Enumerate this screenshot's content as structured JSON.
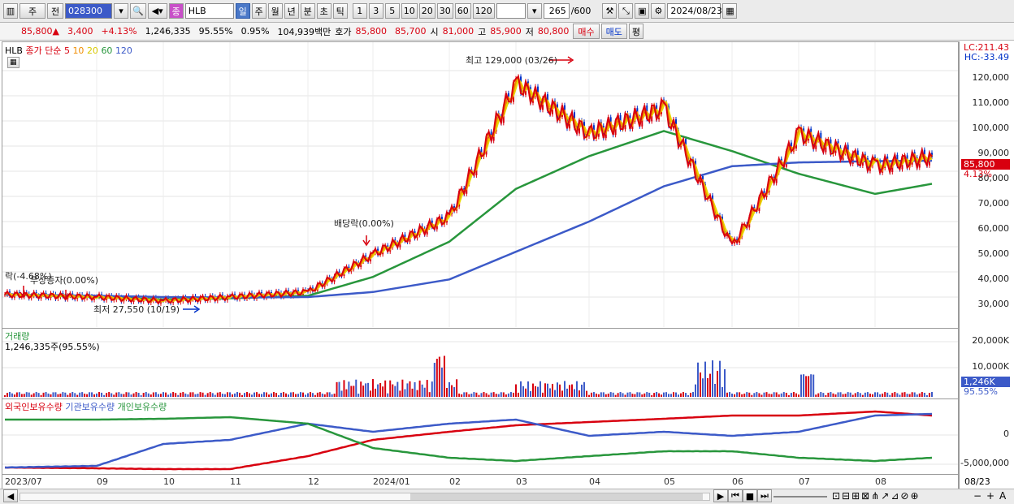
{
  "toolbar": {
    "type": "주",
    "prev": "전",
    "code": "028300",
    "product_icon": "종",
    "name": "HLB",
    "periods": [
      "일",
      "주",
      "월",
      "년",
      "분",
      "초",
      "틱"
    ],
    "active_period": "일",
    "nums": [
      "1",
      "3",
      "5",
      "10",
      "20",
      "30",
      "60",
      "120"
    ],
    "count": "265",
    "count_max": "/600",
    "date": "2024/08/23"
  },
  "quote": {
    "price": "85,800",
    "arrow": "▲",
    "change": "3,400",
    "pct": "+4.13%",
    "volume": "1,246,335",
    "vol_ratio": "95.55%",
    "turnover": "0.95%",
    "amount": "104,939백만",
    "hoga_label": "호가",
    "ask": "85,800",
    "bid": "85,700",
    "open_label": "시",
    "open": "81,000",
    "high_label": "고",
    "high": "85,900",
    "low_label": "저",
    "low": "80,800",
    "buy": "매수",
    "sell": "매도",
    "avg": "평"
  },
  "legend": {
    "name": "HLB",
    "ma_title": "종가 단순",
    "ma": [
      "5",
      "10",
      "20",
      "60",
      "120"
    ],
    "ma_colors": [
      "#d8000f",
      "#f08c00",
      "#e8d800",
      "#28963c",
      "#3c5ac8"
    ]
  },
  "annotations": {
    "high": "최고 129,000 (03/26)",
    "div1": "배당락(0.00%)",
    "left1": "락(-4.68%)",
    "left2": "무상증자(0.00%)",
    "low": "최저 27,550 (10/19)"
  },
  "axis": {
    "lc": "LC:211.43",
    "hc": "HC:-33.49",
    "price_ticks": [
      "120,000",
      "110,000",
      "100,000",
      "90,000",
      "80,000",
      "70,000",
      "60,000",
      "50,000",
      "40,000",
      "30,000"
    ],
    "price_tag": "85,800",
    "pct_tag": "4.13%",
    "vol_ticks": [
      "20,000K",
      "10,000K"
    ],
    "vol_tag": "1,246K",
    "vol_pct": "95.55%",
    "hold_ticks": [
      "0",
      "-5,000,000"
    ]
  },
  "volume": {
    "title": "거래량",
    "value": "1,246,335주(95.55%)"
  },
  "holdings": {
    "series": [
      "외국인보유수량",
      "기관보유수량",
      "개인보유수량"
    ],
    "colors": [
      "#d8000f",
      "#3c5ac8",
      "#28963c"
    ]
  },
  "xlabels": [
    "2023/07",
    "09",
    "10",
    "11",
    "12",
    "2024/01",
    "02",
    "03",
    "04",
    "05",
    "06",
    "07",
    "08",
    "08/23"
  ],
  "chart_data": {
    "type": "line",
    "x": [
      "2023/07",
      "2023/09",
      "2023/10",
      "2023/11",
      "2023/12",
      "2024/01",
      "2024/02",
      "2024/03",
      "2024/04",
      "2024/05",
      "2024/06",
      "2024/07",
      "2024/08",
      "2024/08/23"
    ],
    "series": [
      {
        "name": "종가",
        "values": [
          31000,
          30000,
          28500,
          30000,
          32000,
          47000,
          62000,
          115000,
          95000,
          105000,
          50000,
          95000,
          82000,
          85800
        ]
      },
      {
        "name": "120",
        "values": [
          31000,
          30500,
          30000,
          29800,
          30000,
          32000,
          37000,
          48000,
          60000,
          74000,
          82000,
          83500,
          84000,
          84200
        ]
      },
      {
        "name": "60",
        "values": [
          31000,
          30000,
          29000,
          29500,
          30500,
          38000,
          52000,
          73000,
          86000,
          96000,
          88000,
          79000,
          71000,
          75000
        ]
      }
    ]
  }
}
